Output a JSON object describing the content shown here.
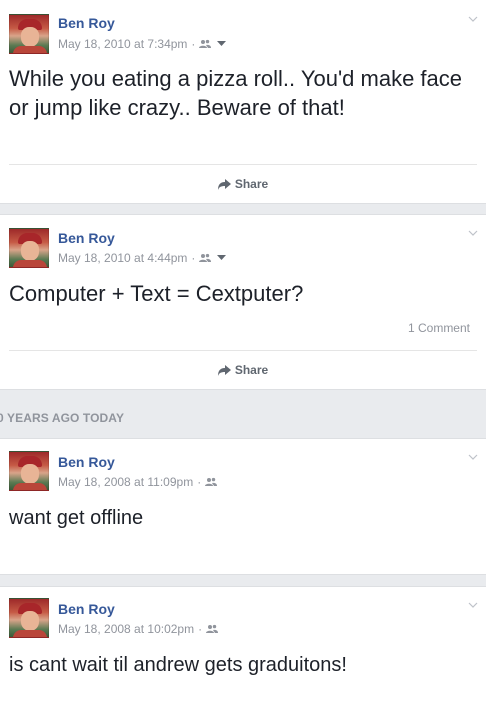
{
  "posts": [
    {
      "author": "Ben Roy",
      "timestamp": "May 18, 2010 at 7:34pm",
      "audience_icon": "friends-icon",
      "has_audience_dropdown": true,
      "text": "While you eating a pizza roll.. You'd make face or jump like crazy.. Beware of that!",
      "share_label": "Share"
    },
    {
      "author": "Ben Roy",
      "timestamp": "May 18, 2010 at 4:44pm",
      "audience_icon": "friends-icon",
      "has_audience_dropdown": true,
      "text": "Computer + Text = Cextputer?",
      "comments_label": "1 Comment",
      "share_label": "Share"
    },
    {
      "author": "Ben Roy",
      "timestamp": "May 18, 2008 at 11:09pm",
      "audience_icon": "friends-icon",
      "text": "want get offline"
    },
    {
      "author": "Ben Roy",
      "timestamp": "May 18, 2008 at 10:02pm",
      "audience_icon": "friends-icon",
      "text": "is cant wait til andrew gets graduitons!"
    }
  ],
  "section_banner": "0 YEARS AGO TODAY",
  "colors": {
    "author": "#365899",
    "meta": "#90949c",
    "background": "#e9ebee"
  }
}
